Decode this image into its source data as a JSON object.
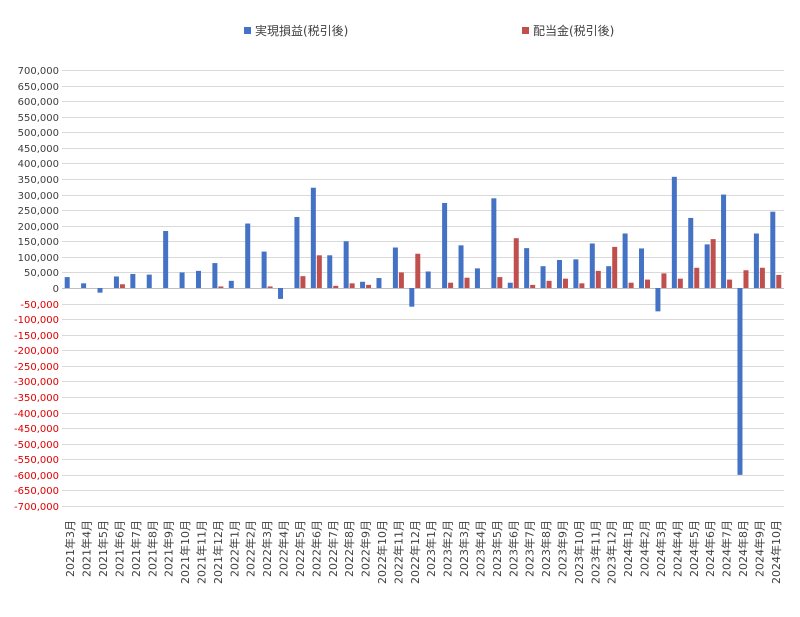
{
  "chart_data": {
    "type": "bar",
    "title": "",
    "xlabel": "",
    "ylabel": "",
    "ylim": [
      -700000,
      700000
    ],
    "ytick_step": 50000,
    "grid": true,
    "legend_position": "top",
    "negative_tick_color": "#e00000",
    "positive_tick_color": "#404040",
    "categories": [
      "2021年3月",
      "2021年4月",
      "2021年5月",
      "2021年6月",
      "2021年7月",
      "2021年8月",
      "2021年9月",
      "2021年10月",
      "2021年11月",
      "2021年12月",
      "2022年1月",
      "2022年2月",
      "2022年3月",
      "2022年4月",
      "2022年5月",
      "2022年6月",
      "2022年7月",
      "2022年8月",
      "2022年9月",
      "2022年10月",
      "2022年11月",
      "2022年12月",
      "2023年1月",
      "2023年2月",
      "2023年3月",
      "2023年4月",
      "2023年5月",
      "2023年6月",
      "2023年7月",
      "2023年8月",
      "2023年9月",
      "2023年10月",
      "2023年11月",
      "2023年12月",
      "2024年1月",
      "2024年2月",
      "2024年3月",
      "2024年4月",
      "2024年5月",
      "2024年6月",
      "2024年7月",
      "2024年8月",
      "2024年9月",
      "2024年10月"
    ],
    "series": [
      {
        "name": "実現損益(税引後)",
        "color": "#4472C4",
        "values": [
          35000,
          15000,
          -15000,
          37000,
          45000,
          43000,
          183000,
          50000,
          55000,
          80000,
          23000,
          207000,
          117000,
          -35000,
          228000,
          322000,
          105000,
          150000,
          20000,
          32000,
          130000,
          -60000,
          53000,
          273000,
          137000,
          63000,
          288000,
          17000,
          128000,
          70000,
          90000,
          92000,
          143000,
          70000,
          175000,
          127000,
          -75000,
          357000,
          225000,
          140000,
          300000,
          -600000,
          175000,
          245000
        ]
      },
      {
        "name": "配当金(税引後)",
        "color": "#C0504D",
        "values": [
          0,
          0,
          0,
          12000,
          0,
          0,
          0,
          0,
          0,
          5000,
          0,
          0,
          5000,
          0,
          38000,
          105000,
          7000,
          15000,
          10000,
          0,
          50000,
          110000,
          0,
          17000,
          33000,
          0,
          35000,
          160000,
          10000,
          23000,
          30000,
          15000,
          55000,
          132000,
          17000,
          27000,
          47000,
          30000,
          65000,
          157000,
          27000,
          57000,
          65000,
          42000
        ]
      }
    ]
  }
}
